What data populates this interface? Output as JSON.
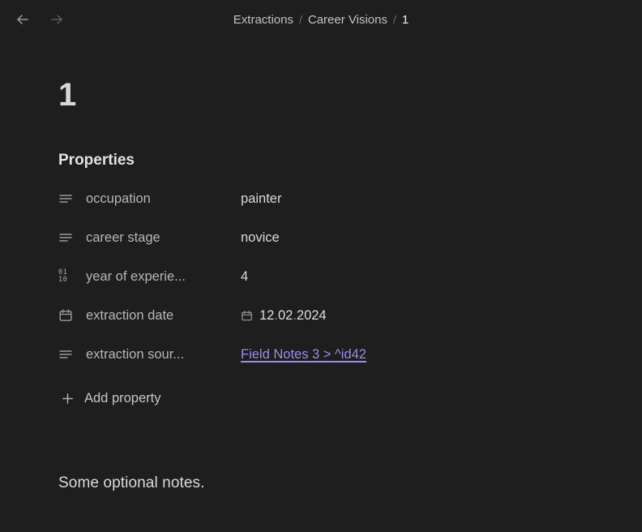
{
  "topbar": {
    "back_icon": "arrow-left-icon",
    "forward_icon": "arrow-right-icon",
    "breadcrumb": {
      "items": [
        {
          "label": "Extractions",
          "current": false
        },
        {
          "label": "Career Visions",
          "current": false
        },
        {
          "label": "1",
          "current": true
        }
      ],
      "separator": "/"
    }
  },
  "page": {
    "title": "1",
    "properties_heading": "Properties",
    "properties": [
      {
        "icon": "text-lines-icon",
        "label": "occupation",
        "value": "painter",
        "type": "text"
      },
      {
        "icon": "text-lines-icon",
        "label": "career stage",
        "value": "novice",
        "type": "text"
      },
      {
        "icon": "binary-number-icon",
        "label": "year of experie...",
        "value": "4",
        "type": "number"
      },
      {
        "icon": "calendar-icon",
        "label": "extraction date",
        "value": "12.02.2024",
        "value_parts": [
          "12",
          ".",
          "02",
          ".",
          "2024"
        ],
        "value_icon": "calendar-icon",
        "type": "date"
      },
      {
        "icon": "text-lines-icon",
        "label": "extraction sour...",
        "value": "Field Notes 3 > ^id42",
        "type": "link"
      }
    ],
    "add_property": {
      "icon": "plus-icon",
      "label": "Add property"
    },
    "notes": "Some optional notes."
  },
  "colors": {
    "background": "#1e1e1e",
    "text_primary": "#d9d9d9",
    "text_muted": "#b6b6b6",
    "link": "#9b8cf0",
    "icon": "#9b9b9b"
  }
}
